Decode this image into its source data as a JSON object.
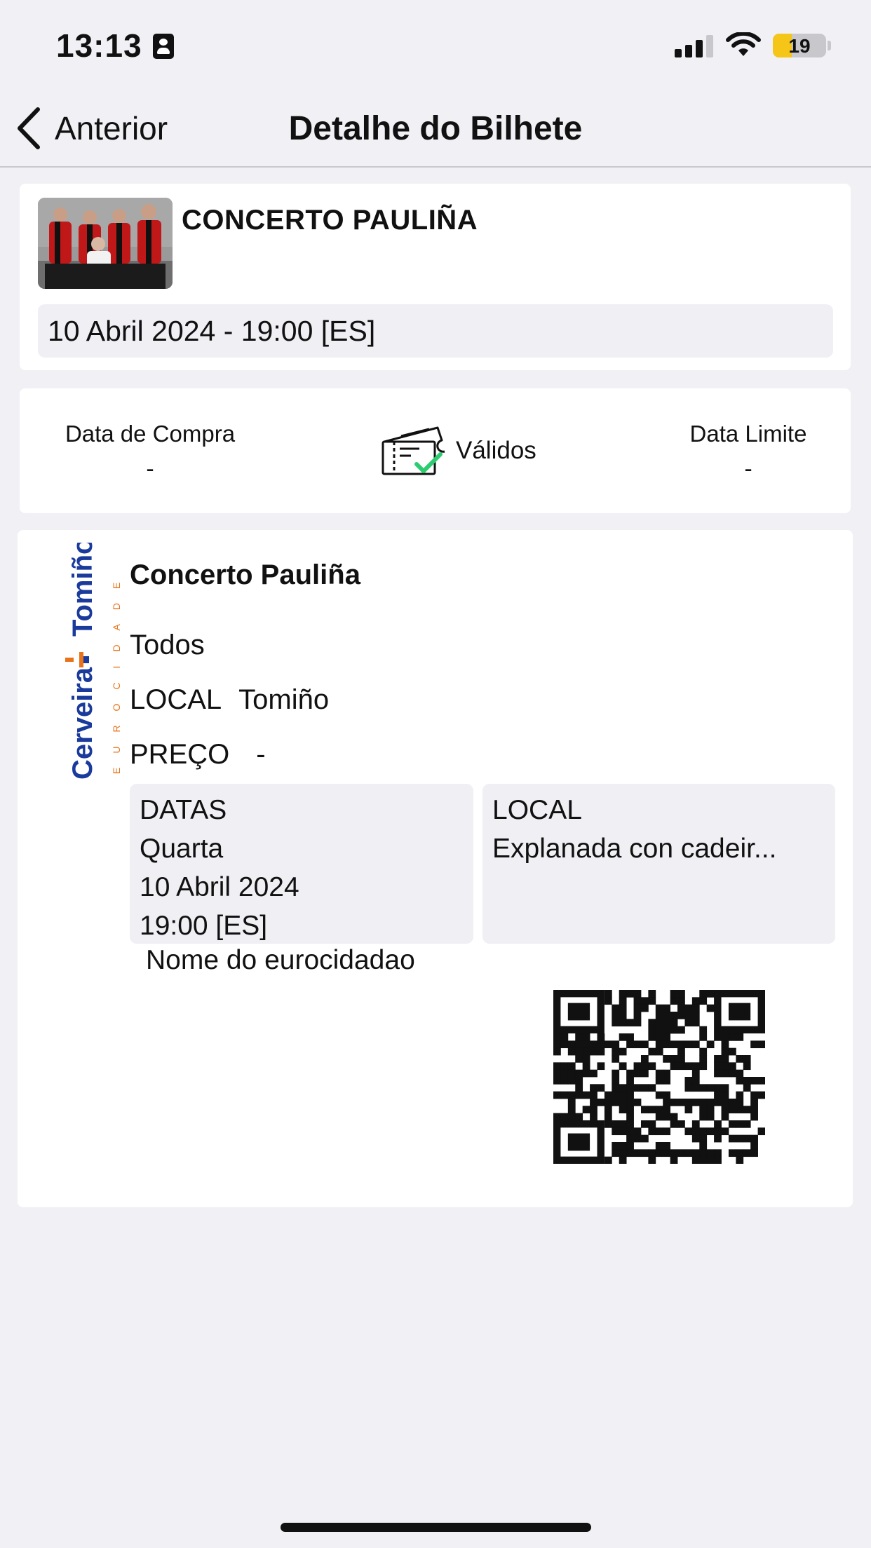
{
  "status_bar": {
    "time": "13:13",
    "battery_level": "19",
    "icons": [
      "contact-card-icon",
      "signal-icon",
      "wifi-icon",
      "battery-icon"
    ]
  },
  "nav": {
    "back_label": "Anterior",
    "title": "Detalhe do Bilhete"
  },
  "event": {
    "title": "CONCERTO PAULIÑA",
    "datetime": "10 Abril 2024 - 19:00 [ES]"
  },
  "purchase_info": {
    "purchase_date_label": "Data de Compra",
    "purchase_date_value": "-",
    "status_label": "Válidos",
    "limit_date_label": "Data Limite",
    "limit_date_value": "-",
    "status_color": "#2ecc71"
  },
  "ticket": {
    "logo_text_main_1": "Cerveira",
    "logo_text_main_2": "Tomiño",
    "logo_text_sub": "EUROCIDADE",
    "logo_colors": {
      "blue": "#1a3a9c",
      "orange": "#e8731a"
    },
    "name": "Concerto Pauliña",
    "audience": "Todos",
    "local_label": "LOCAL",
    "local_value": "Tomiño",
    "price_label": "PREÇO",
    "price_value": "-",
    "datas_label": "DATAS",
    "weekday": "Quarta",
    "date": "10 Abril 2024",
    "time": "19:00 [ES]",
    "venue_label": "LOCAL",
    "venue_value": "Explanada con cadeir...",
    "holder_label": "Nome do eurocidadao"
  }
}
